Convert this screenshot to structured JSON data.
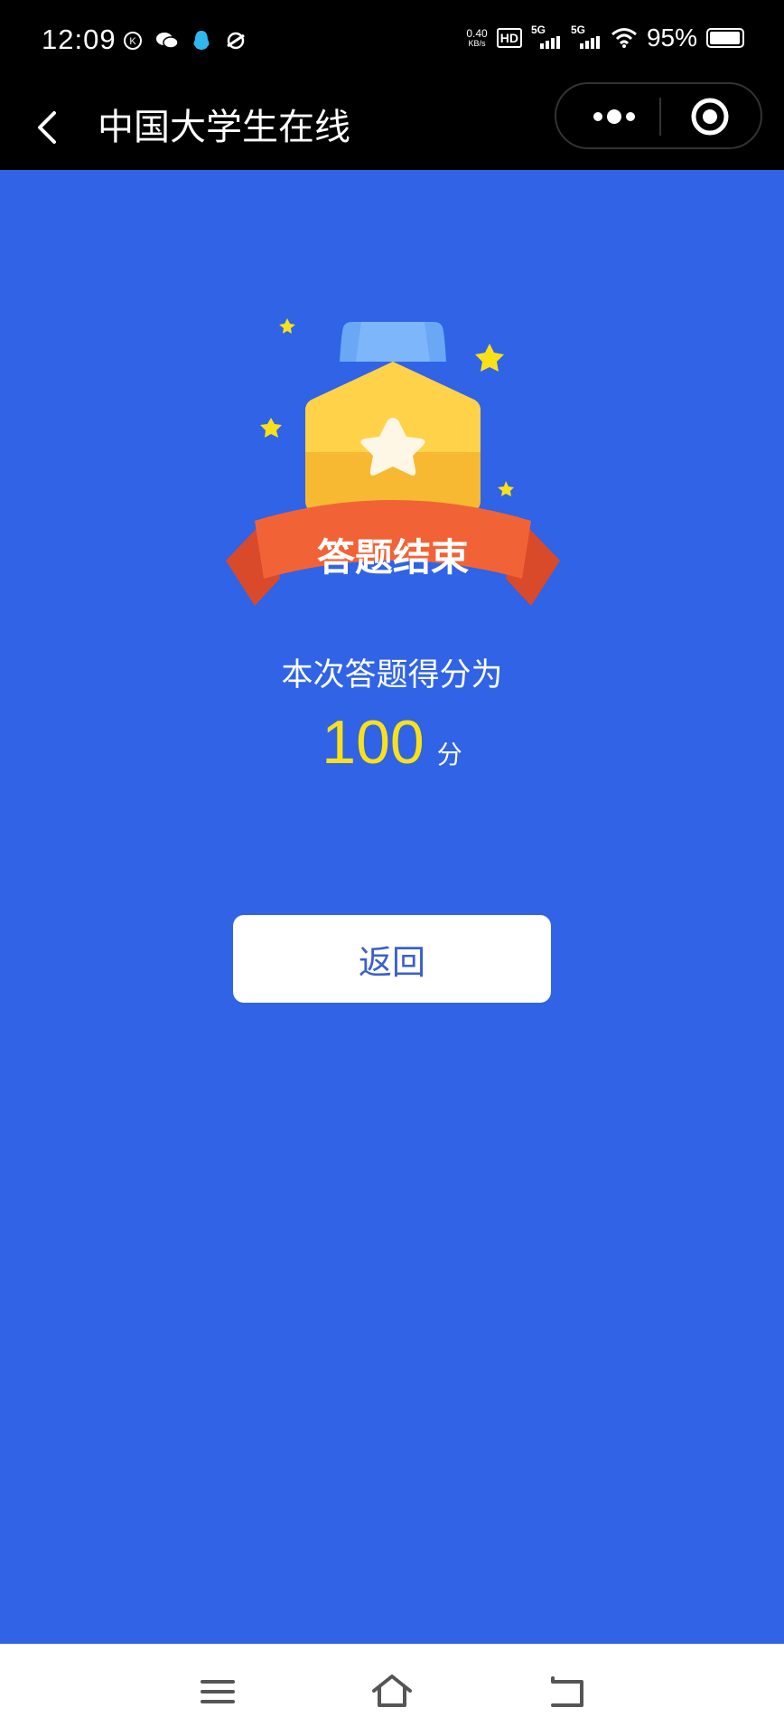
{
  "status_bar": {
    "time": "12:09",
    "net_speed_value": "0.40",
    "net_speed_unit": "KB/s",
    "hd_label": "HD",
    "signal1_label": "5G",
    "signal2_label": "5G",
    "battery": "95%"
  },
  "nav": {
    "title": "中国大学生在线"
  },
  "medal": {
    "ribbon_text": "答题结束"
  },
  "result": {
    "label": "本次答题得分为",
    "score": "100",
    "unit": "分"
  },
  "actions": {
    "return_label": "返回"
  },
  "colors": {
    "background": "#3063e6",
    "score": "#f9e11a",
    "button_text": "#3a5fcf"
  }
}
